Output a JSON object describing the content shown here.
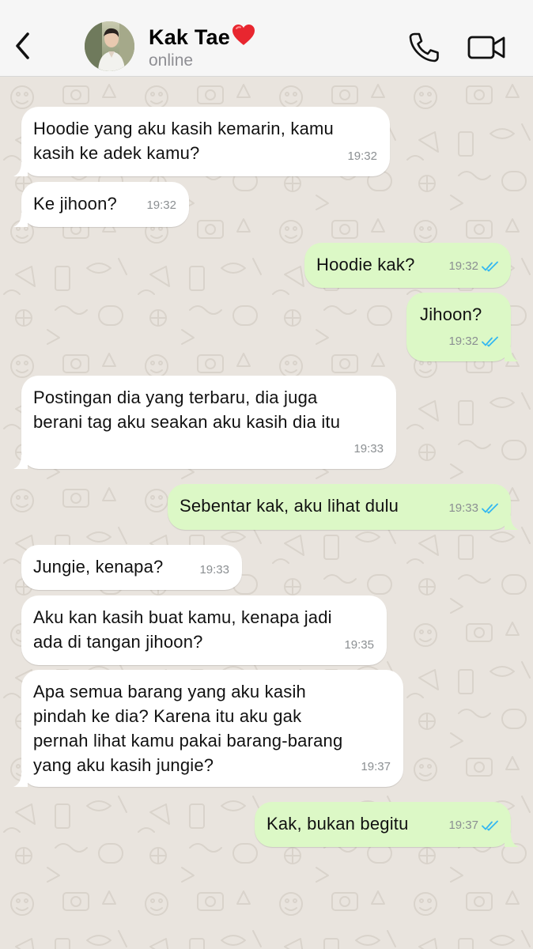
{
  "header": {
    "back_icon": "chevron-left-icon",
    "contact_name": "Kak Tae",
    "name_emoji": "❤️",
    "status": "online",
    "call_icon": "phone-icon",
    "video_icon": "video-camera-icon"
  },
  "colors": {
    "header_bg": "#f6f6f6",
    "wallpaper_bg": "#e9e4de",
    "incoming_bubble": "#ffffff",
    "outgoing_bubble": "#dcf8c6",
    "read_tick": "#34b7f1",
    "timestamp": "#8b8f92",
    "heart": "#e8262f"
  },
  "messages": [
    {
      "direction": "in",
      "text": "Hoodie yang aku kasih kemarin, kamu\nkasih ke adek kamu?",
      "time": "19:32",
      "tail": true
    },
    {
      "direction": "in",
      "text": "Ke jihoon?",
      "time": "19:32",
      "tail": true
    },
    {
      "direction": "out",
      "text": "Hoodie kak?",
      "time": "19:32",
      "status": "read",
      "tail": false
    },
    {
      "direction": "out",
      "text": "Jihoon?",
      "time": "19:32",
      "status": "read",
      "tail": true
    },
    {
      "direction": "in",
      "text": "Postingan dia yang terbaru, dia juga\nberani tag aku seakan aku kasih dia itu",
      "time": "19:33",
      "tail": true
    },
    {
      "direction": "out",
      "text": "Sebentar kak, aku lihat dulu",
      "time": "19:33",
      "status": "read",
      "tail": true
    },
    {
      "direction": "in",
      "text": "Jungie, kenapa?",
      "time": "19:33",
      "tail": false
    },
    {
      "direction": "in",
      "text": "Aku kan kasih buat kamu, kenapa jadi\nada di tangan jihoon?",
      "time": "19:35",
      "tail": false
    },
    {
      "direction": "in",
      "text": "Apa semua barang yang aku kasih\npindah ke dia? Karena itu aku gak\npernah lihat kamu pakai barang-barang\nyang aku kasih jungie?",
      "time": "19:37",
      "tail": true
    },
    {
      "direction": "out",
      "text": "Kak, bukan begitu",
      "time": "19:37",
      "status": "read",
      "tail": true
    }
  ]
}
